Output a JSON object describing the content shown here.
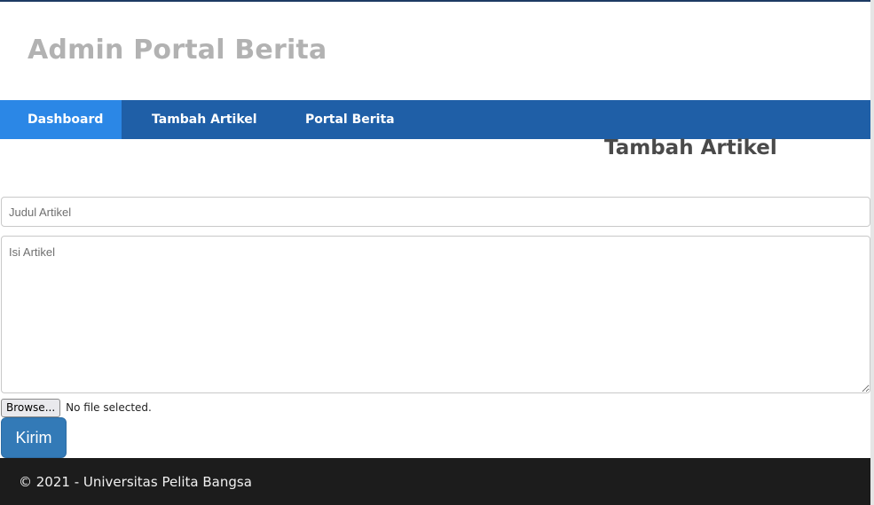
{
  "header": {
    "site_title": "Admin Portal Berita"
  },
  "nav": {
    "items": [
      {
        "label": "Dashboard",
        "active": true
      },
      {
        "label": "Tambah Artikel",
        "active": false
      },
      {
        "label": "Portal Berita",
        "active": false
      }
    ]
  },
  "main": {
    "heading": "Tambah Artikel",
    "title_field": {
      "placeholder": "Judul Artikel",
      "value": ""
    },
    "content_field": {
      "placeholder": "Isi Artikel",
      "value": ""
    },
    "file_input": {
      "button_label": "Browse...",
      "status": "No file selected."
    },
    "submit_label": "Kirim"
  },
  "footer": {
    "text": "© 2021 - Universitas Pelita Bangsa"
  },
  "colors": {
    "nav_background": "#1f5fa7",
    "nav_active": "#2b87e6",
    "submit_button": "#337ab7",
    "footer_background": "#1c1c1c",
    "title_gray": "#b2b2b2"
  }
}
